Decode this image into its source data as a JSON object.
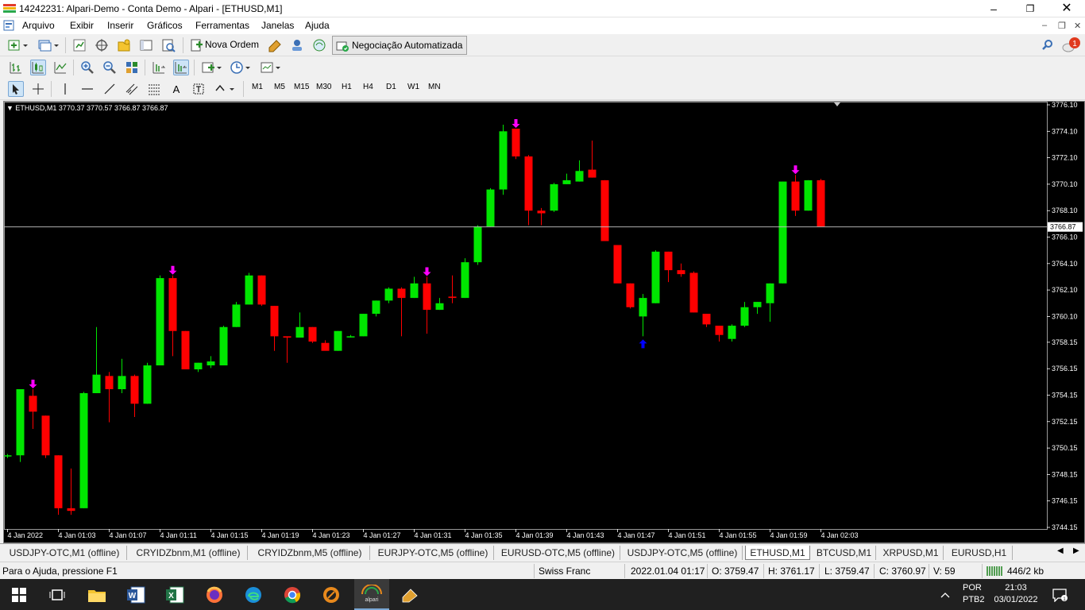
{
  "window": {
    "title": "14242231: Alpari-Demo - Conta Demo - Alpari - [ETHUSD,M1]"
  },
  "menu": [
    "Arquivo",
    "Exibir",
    "Inserir",
    "Gráficos",
    "Ferramentas",
    "Janelas",
    "Ajuda"
  ],
  "toolbar": {
    "new_order_label": "Nova Ordem",
    "auto_trading_label": "Negociação Automatizada",
    "notification_count": "1",
    "timeframes": [
      "M1",
      "M5",
      "M15",
      "M30",
      "H1",
      "H4",
      "D1",
      "W1",
      "MN"
    ]
  },
  "chart": {
    "symbol_info": "ETHUSD,M1  3770.37 3770.57 3766.87 3766.87",
    "current_price_label": "3766.87",
    "colors": {
      "bull": "#00e600",
      "bear": "#ff0000",
      "background": "#000000",
      "arrow_down": "#ff00ff",
      "arrow_up": "#0000ff"
    }
  },
  "chart_data": {
    "type": "candlestick",
    "title": "ETHUSD,M1",
    "ylim": [
      3744.15,
      3776.1
    ],
    "y_ticks": [
      "3776.10",
      "3774.10",
      "3772.10",
      "3770.10",
      "3768.10",
      "3766.10",
      "3764.10",
      "3762.10",
      "3760.10",
      "3758.15",
      "3756.15",
      "3754.15",
      "3752.15",
      "3750.15",
      "3748.15",
      "3746.15",
      "3744.15"
    ],
    "x_labels": [
      "4 Jan 2022",
      "4 Jan 01:03",
      "4 Jan 01:07",
      "4 Jan 01:11",
      "4 Jan 01:15",
      "4 Jan 01:19",
      "4 Jan 01:23",
      "4 Jan 01:27",
      "4 Jan 01:31",
      "4 Jan 01:35",
      "4 Jan 01:39",
      "4 Jan 01:43",
      "4 Jan 01:47",
      "4 Jan 01:51",
      "4 Jan 01:55",
      "4 Jan 01:59",
      "4 Jan 02:03"
    ],
    "current_price": 3766.87,
    "candles": [
      {
        "t": "01:00",
        "o": 3749.6,
        "h": 3749.7,
        "l": 3749.4,
        "c": 3749.6
      },
      {
        "t": "01:00",
        "o": 3749.6,
        "h": 3754.6,
        "l": 3749.1,
        "c": 3754.6
      },
      {
        "t": "01:01",
        "o": 3754.1,
        "h": 3754.6,
        "l": 3751.6,
        "c": 3752.9
      },
      {
        "t": "01:01",
        "o": 3752.6,
        "h": 3752.6,
        "l": 3749.4,
        "c": 3749.6
      },
      {
        "t": "01:02",
        "o": 3749.6,
        "h": 3749.6,
        "l": 3745.1,
        "c": 3745.6
      },
      {
        "t": "01:02",
        "o": 3745.6,
        "h": 3748.6,
        "l": 3745.1,
        "c": 3745.4
      },
      {
        "t": "01:03",
        "o": 3745.6,
        "h": 3754.4,
        "l": 3745.6,
        "c": 3754.3
      },
      {
        "t": "01:03",
        "o": 3754.3,
        "h": 3759.3,
        "l": 3754.3,
        "c": 3755.7
      },
      {
        "t": "01:04",
        "o": 3755.6,
        "h": 3755.9,
        "l": 3752.1,
        "c": 3754.6
      },
      {
        "t": "01:05",
        "o": 3754.6,
        "h": 3756.9,
        "l": 3754.3,
        "c": 3755.6
      },
      {
        "t": "01:06",
        "o": 3755.6,
        "h": 3755.7,
        "l": 3752.5,
        "c": 3753.5
      },
      {
        "t": "01:06",
        "o": 3753.5,
        "h": 3756.6,
        "l": 3753.5,
        "c": 3756.4
      },
      {
        "t": "01:07",
        "o": 3756.4,
        "h": 3763.2,
        "l": 3756.4,
        "c": 3763.0
      },
      {
        "t": "01:08",
        "o": 3763.0,
        "h": 3763.2,
        "l": 3757.1,
        "c": 3759.0
      },
      {
        "t": "01:08",
        "o": 3759.0,
        "h": 3759.0,
        "l": 3756.1,
        "c": 3756.1
      },
      {
        "t": "01:09",
        "o": 3756.1,
        "h": 3756.6,
        "l": 3755.9,
        "c": 3756.6
      },
      {
        "t": "01:10",
        "o": 3756.4,
        "h": 3757.1,
        "l": 3756.2,
        "c": 3756.7
      },
      {
        "t": "01:10",
        "o": 3756.4,
        "h": 3759.4,
        "l": 3756.4,
        "c": 3759.3
      },
      {
        "t": "01:11",
        "o": 3759.3,
        "h": 3761.2,
        "l": 3759.3,
        "c": 3761.0
      },
      {
        "t": "01:12",
        "o": 3761.0,
        "h": 3763.4,
        "l": 3761.0,
        "c": 3763.2
      },
      {
        "t": "01:12",
        "o": 3763.2,
        "h": 3763.2,
        "l": 3760.9,
        "c": 3761.0
      },
      {
        "t": "01:13",
        "o": 3760.9,
        "h": 3760.9,
        "l": 3757.5,
        "c": 3758.6
      },
      {
        "t": "01:14",
        "o": 3758.6,
        "h": 3758.6,
        "l": 3756.6,
        "c": 3758.5
      },
      {
        "t": "01:14",
        "o": 3758.5,
        "h": 3760.4,
        "l": 3758.5,
        "c": 3759.3
      },
      {
        "t": "01:15",
        "o": 3759.3,
        "h": 3759.3,
        "l": 3758.1,
        "c": 3758.2
      },
      {
        "t": "01:16",
        "o": 3758.1,
        "h": 3758.3,
        "l": 3757.7,
        "c": 3757.5
      },
      {
        "t": "01:16",
        "o": 3757.5,
        "h": 3759.0,
        "l": 3757.5,
        "c": 3759.0
      },
      {
        "t": "01:17",
        "o": 3758.6,
        "h": 3758.7,
        "l": 3758.5,
        "c": 3758.6
      },
      {
        "t": "01:18",
        "o": 3758.6,
        "h": 3760.3,
        "l": 3758.6,
        "c": 3760.3
      },
      {
        "t": "01:18",
        "o": 3760.3,
        "h": 3761.3,
        "l": 3760.1,
        "c": 3761.3
      },
      {
        "t": "01:19",
        "o": 3761.3,
        "h": 3762.3,
        "l": 3761.1,
        "c": 3762.2
      },
      {
        "t": "01:20",
        "o": 3762.2,
        "h": 3762.3,
        "l": 3758.6,
        "c": 3761.5
      },
      {
        "t": "01:20",
        "o": 3761.5,
        "h": 3763.1,
        "l": 3761.5,
        "c": 3762.6
      },
      {
        "t": "01:21",
        "o": 3762.6,
        "h": 3763.1,
        "l": 3758.8,
        "c": 3760.6
      },
      {
        "t": "01:22",
        "o": 3760.6,
        "h": 3761.5,
        "l": 3760.6,
        "c": 3761.1
      },
      {
        "t": "01:22",
        "o": 3761.6,
        "h": 3763.2,
        "l": 3761.1,
        "c": 3761.5
      },
      {
        "t": "01:23",
        "o": 3761.5,
        "h": 3764.5,
        "l": 3761.5,
        "c": 3764.2
      },
      {
        "t": "01:24",
        "o": 3764.2,
        "h": 3767.0,
        "l": 3764.0,
        "c": 3766.9
      },
      {
        "t": "01:24",
        "o": 3766.9,
        "h": 3769.8,
        "l": 3766.9,
        "c": 3769.7
      },
      {
        "t": "01:25",
        "o": 3769.7,
        "h": 3774.6,
        "l": 3769.3,
        "c": 3774.1
      },
      {
        "t": "01:26",
        "o": 3774.3,
        "h": 3774.3,
        "l": 3772.0,
        "c": 3772.2
      },
      {
        "t": "01:26",
        "o": 3772.2,
        "h": 3772.3,
        "l": 3767.0,
        "c": 3768.1
      },
      {
        "t": "01:27",
        "o": 3768.1,
        "h": 3768.3,
        "l": 3767.0,
        "c": 3767.9
      },
      {
        "t": "01:28",
        "o": 3768.1,
        "h": 3770.2,
        "l": 3768.0,
        "c": 3770.1
      },
      {
        "t": "01:28",
        "o": 3770.1,
        "h": 3770.9,
        "l": 3770.1,
        "c": 3770.4
      },
      {
        "t": "01:29",
        "o": 3770.3,
        "h": 3771.9,
        "l": 3770.3,
        "c": 3771.1
      },
      {
        "t": "01:30",
        "o": 3771.2,
        "h": 3773.4,
        "l": 3770.6,
        "c": 3770.6
      },
      {
        "t": "01:30",
        "o": 3770.4,
        "h": 3770.4,
        "l": 3766.3,
        "c": 3765.8
      },
      {
        "t": "01:31",
        "o": 3765.5,
        "h": 3765.5,
        "l": 3762.7,
        "c": 3762.6
      },
      {
        "t": "01:32",
        "o": 3762.6,
        "h": 3762.6,
        "l": 3760.7,
        "c": 3760.8
      },
      {
        "t": "01:32",
        "o": 3760.1,
        "h": 3761.8,
        "l": 3758.6,
        "c": 3761.5
      },
      {
        "t": "01:33",
        "o": 3761.1,
        "h": 3765.1,
        "l": 3761.1,
        "c": 3765.0
      },
      {
        "t": "01:34",
        "o": 3765.0,
        "h": 3765.0,
        "l": 3762.7,
        "c": 3763.6
      },
      {
        "t": "01:35",
        "o": 3763.6,
        "h": 3764.1,
        "l": 3763.1,
        "c": 3763.3
      },
      {
        "t": "01:35",
        "o": 3763.4,
        "h": 3763.5,
        "l": 3760.4,
        "c": 3760.4
      },
      {
        "t": "01:36",
        "o": 3760.3,
        "h": 3760.3,
        "l": 3759.3,
        "c": 3759.5
      },
      {
        "t": "01:37",
        "o": 3759.4,
        "h": 3759.4,
        "l": 3758.2,
        "c": 3758.7
      },
      {
        "t": "01:37",
        "o": 3758.4,
        "h": 3759.5,
        "l": 3758.2,
        "c": 3759.4
      },
      {
        "t": "01:38",
        "o": 3759.4,
        "h": 3761.2,
        "l": 3759.3,
        "c": 3760.8
      },
      {
        "t": "01:39",
        "o": 3760.8,
        "h": 3761.2,
        "l": 3760.3,
        "c": 3761.2
      },
      {
        "t": "01:39",
        "o": 3761.1,
        "h": 3762.6,
        "l": 3759.7,
        "c": 3762.6
      },
      {
        "t": "01:40",
        "o": 3762.6,
        "h": 3770.3,
        "l": 3762.6,
        "c": 3770.3
      },
      {
        "t": "01:41",
        "o": 3770.3,
        "h": 3770.8,
        "l": 3767.7,
        "c": 3768.1
      },
      {
        "t": "01:41",
        "o": 3768.1,
        "h": 3770.4,
        "l": 3768.1,
        "c": 3770.4
      },
      {
        "t": "01:42",
        "o": 3770.4,
        "h": 3770.5,
        "l": 3766.9,
        "c": 3766.9
      }
    ],
    "signals": [
      {
        "index": 2,
        "dir": "down"
      },
      {
        "index": 13,
        "dir": "down"
      },
      {
        "index": 33,
        "dir": "down"
      },
      {
        "index": 40,
        "dir": "down"
      },
      {
        "index": 50,
        "dir": "up"
      },
      {
        "index": 62,
        "dir": "down"
      }
    ]
  },
  "tabs": [
    {
      "label": "USDJPY-OTC,M1 (offline)",
      "active": false
    },
    {
      "label": "CRYIDZbnm,M1 (offline)",
      "active": false
    },
    {
      "label": "CRYIDZbnm,M5 (offline)",
      "active": false
    },
    {
      "label": "EURJPY-OTC,M5 (offline)",
      "active": false
    },
    {
      "label": "EURUSD-OTC,M5 (offline)",
      "active": false
    },
    {
      "label": "USDJPY-OTC,M5 (offline)",
      "active": false
    },
    {
      "label": "ETHUSD,M1",
      "active": true
    },
    {
      "label": "BTCUSD,M1",
      "active": false
    },
    {
      "label": "XRPUSD,M1",
      "active": false
    },
    {
      "label": "EURUSD,H1",
      "active": false
    }
  ],
  "status": {
    "help": "Para o Ajuda, pressione F1",
    "profile": "Swiss Franc",
    "datetime": "2022.01.04 01:17",
    "open": "O: 3759.47",
    "high": "H: 3761.17",
    "low": "L: 3759.47",
    "close": "C: 3760.97",
    "volume": "V: 59",
    "traffic": "446/2 kb"
  },
  "taskbar": {
    "lang1": "POR",
    "lang2": "PTB2",
    "time": "21:03",
    "date": "03/01/2022"
  }
}
